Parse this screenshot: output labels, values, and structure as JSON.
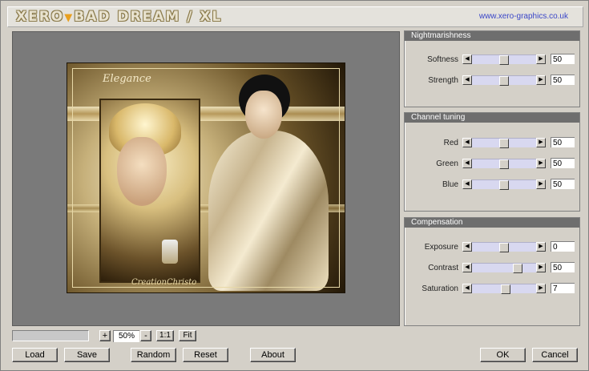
{
  "title": {
    "logo_part1": "XERO",
    "logo_part2": "BAD DREAM / XL",
    "url": "www.xero-graphics.co.uk"
  },
  "preview": {
    "signature_top": "Elegance",
    "signature_bottom": "CreationChristo"
  },
  "panels": {
    "nightmarishness": {
      "heading": "Nightmarishness",
      "sliders": [
        {
          "label": "Softness",
          "value": "50",
          "level": 0.5
        },
        {
          "label": "Strength",
          "value": "50",
          "level": 0.5
        }
      ]
    },
    "channel": {
      "heading": "Channel tuning",
      "sliders": [
        {
          "label": "Red",
          "value": "50",
          "level": 0.5
        },
        {
          "label": "Green",
          "value": "50",
          "level": 0.5
        },
        {
          "label": "Blue",
          "value": "50",
          "level": 0.5
        }
      ]
    },
    "compensation": {
      "heading": "Compensation",
      "sliders": [
        {
          "label": "Exposure",
          "value": "0",
          "level": 0.5
        },
        {
          "label": "Contrast",
          "value": "50",
          "level": 0.75
        },
        {
          "label": "Saturation",
          "value": "7",
          "level": 0.53
        }
      ]
    }
  },
  "zoom": {
    "plus": "+",
    "value": "50%",
    "minus": "-",
    "one_to_one": "1:1",
    "fit": "Fit"
  },
  "buttons": {
    "load": "Load",
    "save": "Save",
    "random": "Random",
    "reset": "Reset",
    "about": "About",
    "ok": "OK",
    "cancel": "Cancel"
  },
  "arrows": {
    "left": "◀",
    "right": "▶"
  }
}
